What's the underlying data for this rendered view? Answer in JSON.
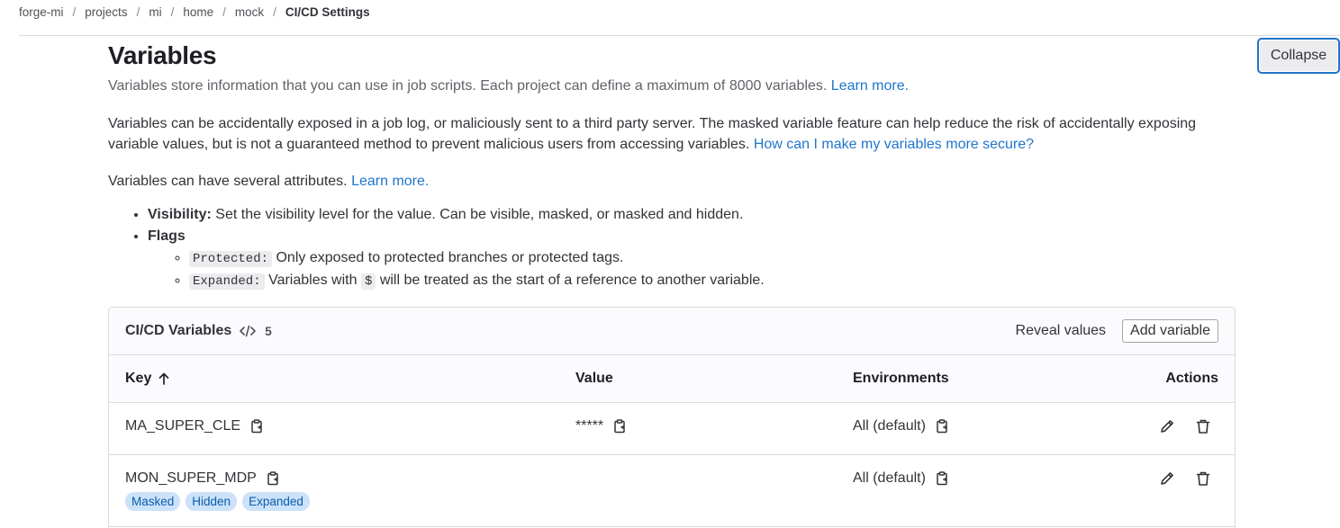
{
  "breadcrumb": [
    "forge-mi",
    "projects",
    "mi",
    "home",
    "mock",
    "CI/CD Settings"
  ],
  "collapse_label": "Collapse",
  "section": {
    "title": "Variables",
    "subtitle": "Variables store information that you can use in job scripts. Each project can define a maximum of 8000 variables.",
    "subtitle_link": "Learn more.",
    "para1": "Variables can be accidentally exposed in a job log, or maliciously sent to a third party server. The masked variable feature can help reduce the risk of accidentally exposing variable values, but is not a guaranteed method to prevent malicious users from accessing variables.",
    "para1_link": "How can I make my variables more secure?",
    "para2": "Variables can have several attributes.",
    "para2_link": "Learn more.",
    "visibility_label": "Visibility:",
    "visibility_text": "Set the visibility level for the value. Can be visible, masked, or masked and hidden.",
    "flags_label": "Flags",
    "protected_code": "Protected:",
    "protected_text": "Only exposed to protected branches or protected tags.",
    "expanded_code": "Expanded:",
    "expanded_text_a": "Variables with",
    "dollar_code": "$",
    "expanded_text_b": "will be treated as the start of a reference to another variable."
  },
  "card": {
    "title": "CI/CD Variables",
    "count": "5",
    "reveal_label": "Reveal values",
    "add_label": "Add variable",
    "columns": {
      "key": "Key",
      "value": "Value",
      "environments": "Environments",
      "actions": "Actions"
    },
    "rows": [
      {
        "key": "MA_SUPER_CLE",
        "value": "*****",
        "env": "All (default)",
        "badges": []
      },
      {
        "key": "MON_SUPER_MDP",
        "value": "",
        "env": "All (default)",
        "badges": [
          "Masked",
          "Hidden",
          "Expanded"
        ]
      }
    ]
  },
  "icons": {
    "copy": "clipboard-icon",
    "edit": "pencil-icon",
    "delete": "trash-icon",
    "sort": "arrow-up-icon",
    "code": "code-icon"
  },
  "colors": {
    "link": "#1f75cb",
    "badge_bg": "#cbe2f9",
    "badge_text": "#0b5cad",
    "border": "#dcdcde"
  }
}
